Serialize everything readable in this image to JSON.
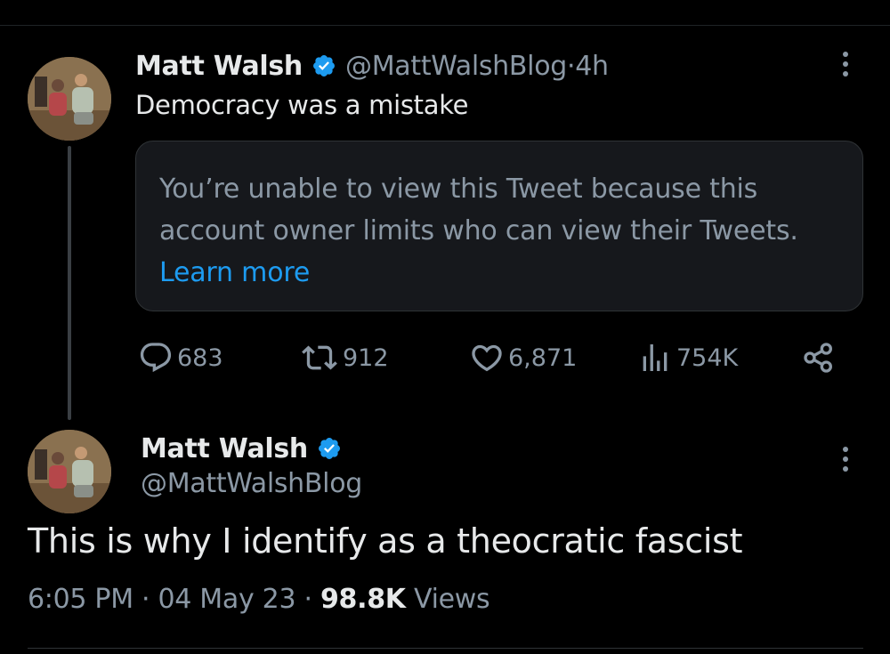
{
  "tweet1": {
    "author_name": "Matt Walsh",
    "handle": "@MattWalshBlog",
    "separator": " · ",
    "time": "4h",
    "text": "Democracy was a mistake",
    "quote_card": {
      "message": "You’re unable to view this Tweet because this account owner limits who can view their Tweets.",
      "link": "Learn more"
    },
    "metrics": {
      "replies": "683",
      "retweets": "912",
      "likes": "6,871",
      "views": "754K"
    }
  },
  "tweet2": {
    "author_name": "Matt Walsh",
    "handle": "@MattWalshBlog",
    "text": "This is why I identify as a theocratic fascist",
    "time": "6:05 PM",
    "dot1": " · ",
    "date": "04 May 23",
    "dot2": " · ",
    "views_count": "98.8K",
    "views_label": "Views"
  },
  "colors": {
    "background": "#000000",
    "primary_text": "#e7e9ea",
    "secondary_text": "#8b98a5",
    "link": "#1d9bf0",
    "verified_badge": "#1d9bf0"
  },
  "icons": [
    "verified-badge-icon",
    "more-options-icon",
    "reply-icon",
    "retweet-icon",
    "like-icon",
    "views-icon",
    "share-icon"
  ]
}
